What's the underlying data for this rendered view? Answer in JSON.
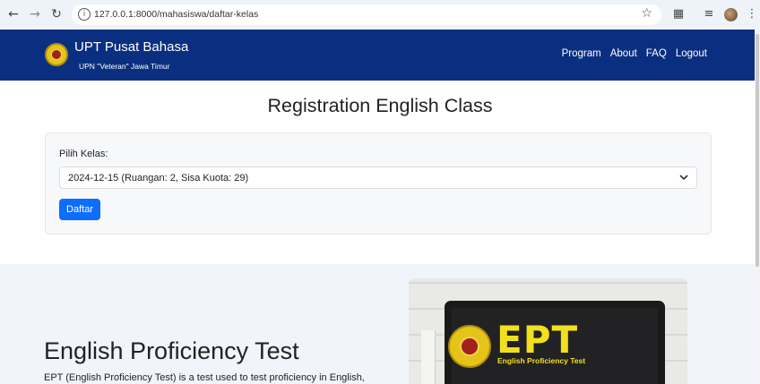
{
  "browser": {
    "url": "127.0.0.1:8000/mahasiswa/daftar-kelas",
    "icons": [
      "back-icon",
      "forward-icon",
      "reload-icon",
      "info-icon",
      "star-icon",
      "extensions-icon",
      "reading-list-icon",
      "profile-avatar",
      "menu-icon"
    ]
  },
  "header": {
    "title": "UPT Pusat Bahasa",
    "subtitle": "UPN \"Veteran\" Jawa Timur",
    "nav": [
      "Program",
      "About",
      "FAQ",
      "Logout"
    ]
  },
  "registration": {
    "title": "Registration English Class",
    "label": "Pilih Kelas:",
    "selected_class": "2024-12-15 (Ruangan: 2, Sisa Kuota: 29)",
    "button": "Daftar"
  },
  "ept": {
    "title": "English Proficiency Test",
    "description": "EPT (English Proficiency Test) is a test used to test proficiency in English,",
    "image_mark": "EPT",
    "image_caption": "English Proficiency Test"
  },
  "colors": {
    "navbar": "#0b2f80",
    "primary_button": "#0d6efd",
    "ept_yellow": "#f2e01e"
  }
}
